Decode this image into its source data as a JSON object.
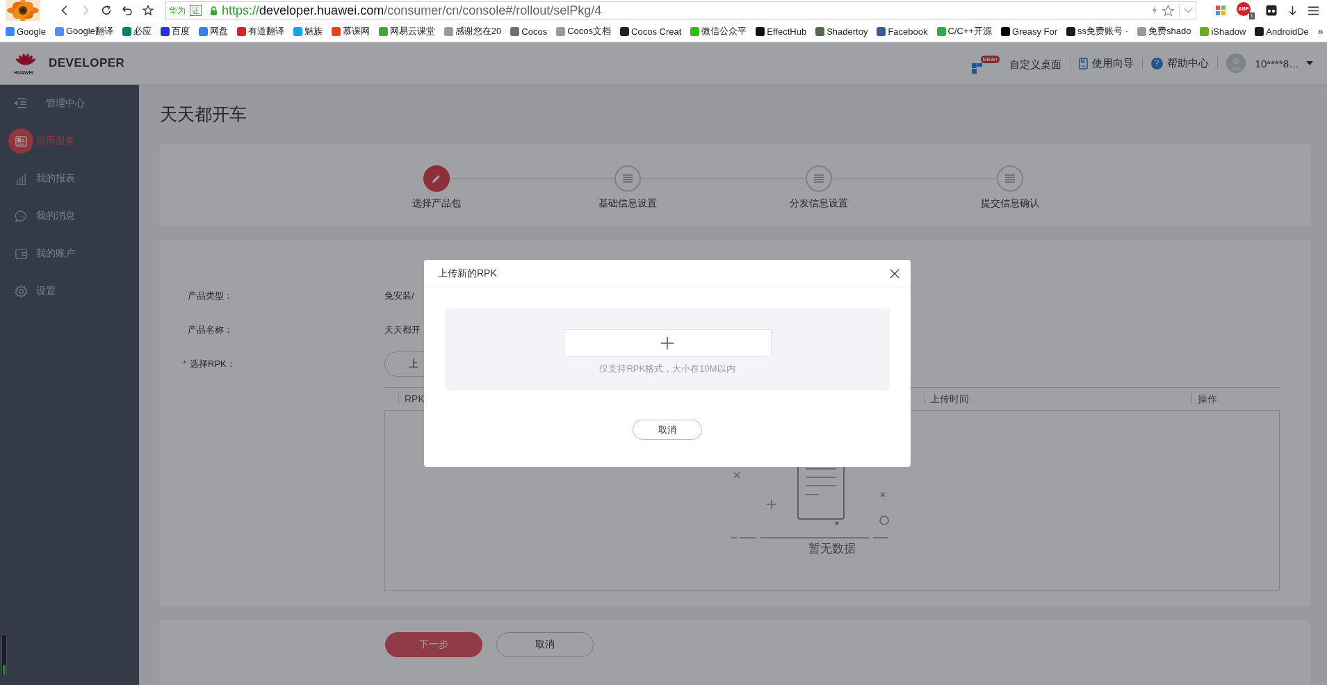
{
  "browser": {
    "nav": [
      {
        "kind": "back",
        "disabled": false
      },
      {
        "kind": "forward",
        "disabled": true
      },
      {
        "kind": "reload",
        "disabled": false
      },
      {
        "kind": "undo",
        "disabled": false
      },
      {
        "kind": "star",
        "disabled": false
      }
    ],
    "address": {
      "badge_1": "华为",
      "badge_2": "证",
      "url": {
        "scheme": "https://",
        "host": "developer.huawei.com",
        "path": "/consumer/cn/console#/rollout/selPkg/4"
      }
    },
    "extensions": [
      {
        "kind": "tiles"
      },
      {
        "kind": "abp",
        "label": "ABP",
        "badge": "1"
      },
      {
        "kind": "ghost"
      },
      {
        "kind": "download"
      },
      {
        "kind": "menu"
      }
    ],
    "bookmarks": [
      {
        "label": "Google",
        "color": "#4285f4"
      },
      {
        "label": "Google翻译",
        "color": "#5b8def"
      },
      {
        "label": "必应",
        "color": "#008373"
      },
      {
        "label": "百度",
        "color": "#2932e1"
      },
      {
        "label": "网盘",
        "color": "#3b7de9"
      },
      {
        "label": "有道翻译",
        "color": "#e02020"
      },
      {
        "label": "魅族",
        "color": "#1aa3e8"
      },
      {
        "label": "慕课网",
        "color": "#f23c1e"
      },
      {
        "label": "网易云课堂",
        "color": "#3aa83a"
      },
      {
        "label": "感谢您在20",
        "color": "#9a9a9a"
      },
      {
        "label": "Cocos",
        "color": "#707070"
      },
      {
        "label": "Cocos文档",
        "color": "#9a9a9a"
      },
      {
        "label": "Cocos Creat",
        "color": "#222222"
      },
      {
        "label": "微信公众平",
        "color": "#2dc100"
      },
      {
        "label": "EffectHub",
        "color": "#111111"
      },
      {
        "label": "Shadertoy",
        "color": "#556b50"
      },
      {
        "label": "Facebook",
        "color": "#3b5998"
      },
      {
        "label": "C/C++开源",
        "color": "#2fa84f"
      },
      {
        "label": "Greasy For",
        "color": "#000000"
      },
      {
        "label": "ss免费账号 ·",
        "color": "#1b1b1b"
      },
      {
        "label": "免费shado",
        "color": "#9a9a9a"
      },
      {
        "label": "iShadow",
        "color": "#6aae1a"
      },
      {
        "label": "AndroidDe",
        "color": "#1c1c1c"
      }
    ],
    "bookmarks_more": "»"
  },
  "header": {
    "brand_small": "HUAWEI",
    "brand": "DEVELOPER",
    "links": [
      {
        "kind": "desktop",
        "label": "自定义桌面",
        "badge": "NEW!"
      },
      {
        "kind": "guide",
        "label": "使用向导"
      },
      {
        "kind": "help",
        "label": "帮助中心",
        "glyph": "?"
      }
    ],
    "user": {
      "name": "10****8…"
    }
  },
  "sidebar": {
    "title": "管理中心",
    "items": [
      {
        "kind": "app",
        "label": "应用服务",
        "selected": true
      },
      {
        "kind": "report",
        "label": "我的报表",
        "selected": false
      },
      {
        "kind": "message",
        "label": "我的消息",
        "selected": false
      },
      {
        "kind": "account",
        "label": "我的账户",
        "selected": false
      },
      {
        "kind": "settings",
        "label": "设置",
        "selected": false
      }
    ]
  },
  "page": {
    "title": "天天都开车",
    "steps": [
      {
        "label": "选择产品包",
        "selected": true
      },
      {
        "label": "基础信息设置",
        "selected": false
      },
      {
        "label": "分发信息设置",
        "selected": false
      },
      {
        "label": "提交信息确认",
        "selected": false
      }
    ],
    "form": [
      {
        "kind": "text",
        "label": "产品类型：",
        "value": "免安装/"
      },
      {
        "kind": "text",
        "label": "产品名称：",
        "value": "天天都开"
      },
      {
        "kind": "upload",
        "label": "选择RPK：",
        "mark": "*",
        "button": "上"
      }
    ],
    "table": {
      "columns": [
        "RPK",
        "上传时间",
        "操作"
      ],
      "empty": "暂无数据"
    },
    "actions": [
      {
        "kind": "primary",
        "label": "下一步"
      },
      {
        "kind": "secondary",
        "label": "取消"
      }
    ]
  },
  "dialog": {
    "title": "上传新的RPK",
    "hint": "仅支持RPK格式，大小在10M以内",
    "cancel": "取消"
  }
}
